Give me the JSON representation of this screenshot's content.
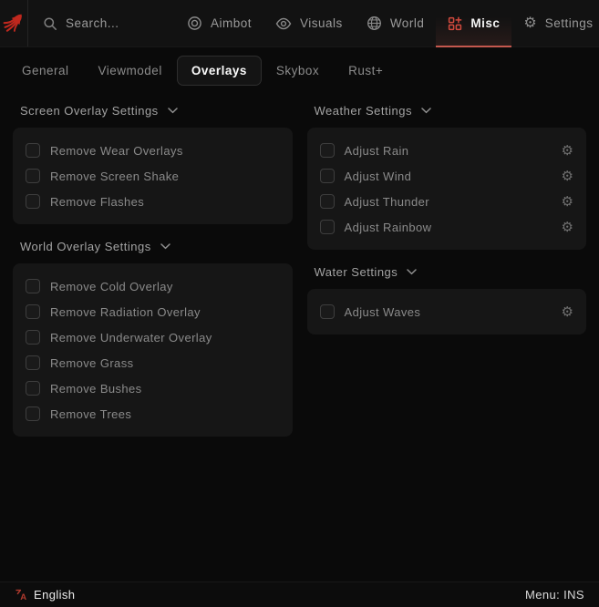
{
  "topbar": {
    "search": {
      "placeholder": "Search..."
    },
    "nav": [
      {
        "label": "Aimbot",
        "icon": "target-icon",
        "active": false
      },
      {
        "label": "Visuals",
        "icon": "eye-icon",
        "active": false
      },
      {
        "label": "World",
        "icon": "globe-icon",
        "active": false
      },
      {
        "label": "Misc",
        "icon": "grid-plus-icon",
        "active": true
      },
      {
        "label": "Settings",
        "icon": "gear-icon",
        "active": false
      }
    ]
  },
  "tabs": [
    {
      "label": "General",
      "active": false
    },
    {
      "label": "Viewmodel",
      "active": false
    },
    {
      "label": "Overlays",
      "active": true
    },
    {
      "label": "Skybox",
      "active": false
    },
    {
      "label": "Rust+",
      "active": false
    }
  ],
  "sections": {
    "left": [
      {
        "title": "Screen Overlay Settings",
        "items": [
          {
            "label": "Remove Wear Overlays",
            "checked": false
          },
          {
            "label": "Remove Screen Shake",
            "checked": false
          },
          {
            "label": "Remove Flashes",
            "checked": false
          }
        ]
      },
      {
        "title": "World Overlay Settings",
        "items": [
          {
            "label": "Remove Cold Overlay",
            "checked": false
          },
          {
            "label": "Remove Radiation Overlay",
            "checked": false
          },
          {
            "label": "Remove Underwater Overlay",
            "checked": false
          },
          {
            "label": "Remove Grass",
            "checked": false
          },
          {
            "label": "Remove Bushes",
            "checked": false
          },
          {
            "label": "Remove Trees",
            "checked": false
          }
        ]
      }
    ],
    "right": [
      {
        "title": "Weather Settings",
        "items": [
          {
            "label": "Adjust Rain",
            "checked": false,
            "has_settings": true
          },
          {
            "label": "Adjust Wind",
            "checked": false,
            "has_settings": true
          },
          {
            "label": "Adjust Thunder",
            "checked": false,
            "has_settings": true
          },
          {
            "label": "Adjust Rainbow",
            "checked": false,
            "has_settings": true
          }
        ]
      },
      {
        "title": "Water Settings",
        "items": [
          {
            "label": "Adjust Waves",
            "checked": false,
            "has_settings": true
          }
        ]
      }
    ]
  },
  "footer": {
    "language": "English",
    "menu_key": "Menu: INS"
  },
  "icons": {
    "gear_glyph": "⚙"
  },
  "colors": {
    "accent_red": "#c0392b",
    "underline_red": "#c4584e",
    "misc_icon_red": "#d24a3e",
    "card_bg": "#161616",
    "topbar_bg": "#121212",
    "page_bg": "#0a0a0a"
  }
}
